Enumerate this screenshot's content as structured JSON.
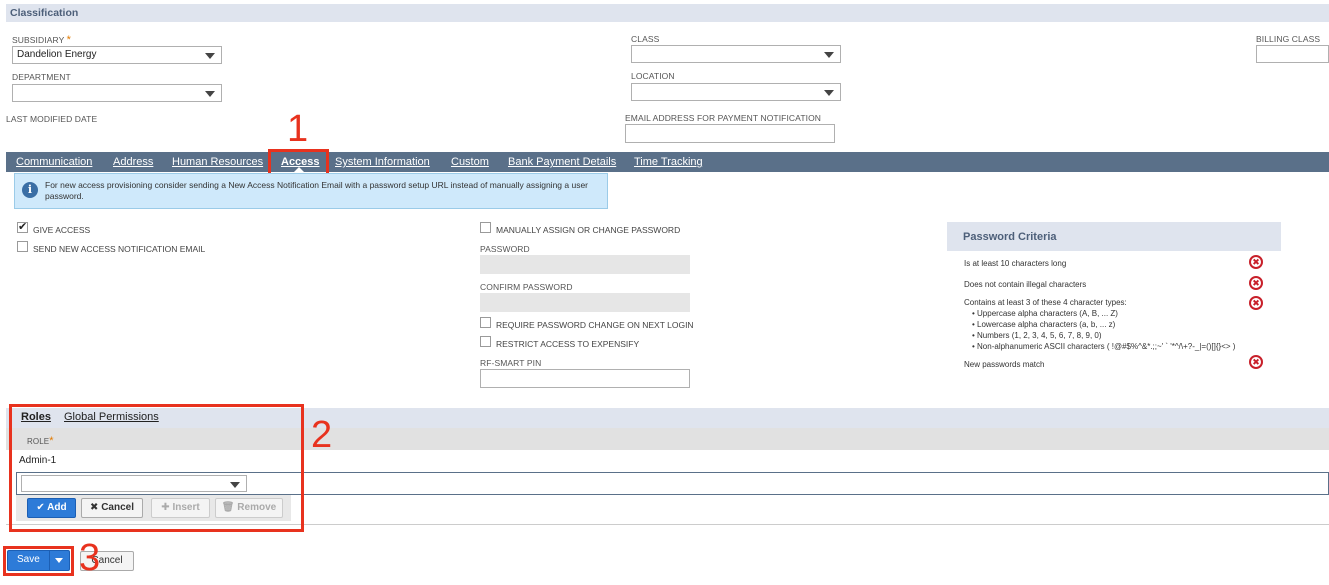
{
  "classification": {
    "title": "Classification",
    "subsidiary_label": "SUBSIDIARY",
    "required_star": "*",
    "subsidiary_value": "Dandelion Energy",
    "department_label": "DEPARTMENT",
    "class_label": "CLASS",
    "location_label": "LOCATION",
    "billing_class_label": "BILLING CLASS",
    "last_modified_label": "LAST MODIFIED DATE",
    "email_payment_label": "EMAIL ADDRESS FOR PAYMENT NOTIFICATION"
  },
  "tabs": [
    {
      "label": "Communication"
    },
    {
      "label": "Address"
    },
    {
      "label": "Human Resources"
    },
    {
      "label": "Access"
    },
    {
      "label": "System Information"
    },
    {
      "label": "Custom"
    },
    {
      "label": "Bank Payment Details"
    },
    {
      "label": "Time Tracking"
    }
  ],
  "annotations": {
    "one": "1",
    "two": "2",
    "three": "3"
  },
  "info_banner": {
    "icon": "i",
    "text": "For new access provisioning consider sending a New Access Notification Email with a password setup URL instead of manually assigning a user password."
  },
  "access": {
    "give_access": "GIVE ACCESS",
    "send_notification": "SEND NEW ACCESS NOTIFICATION EMAIL",
    "manually_assign": "MANUALLY ASSIGN OR CHANGE PASSWORD",
    "password_label": "PASSWORD",
    "confirm_password_label": "CONFIRM PASSWORD",
    "require_change": "REQUIRE PASSWORD CHANGE ON NEXT LOGIN",
    "restrict_access": "RESTRICT ACCESS TO EXPENSIFY",
    "rf_smart_pin_label": "RF-SMART PIN"
  },
  "password_criteria": {
    "title": "Password Criteria",
    "items": [
      "Is at least 10 characters long",
      "Does not contain illegal characters",
      "Contains at least 3 of these 4 character types:",
      "New passwords match"
    ],
    "types": [
      "• Uppercase alpha characters (A, B, ... Z)",
      "• Lowercase alpha characters (a, b, ... z)",
      "• Numbers (1, 2, 3, 4, 5, 6, 7, 8, 9, 0)",
      "• Non-alphanumeric ASCII characters ( !@#$%^&*.;;~' ` '*^/\\+?-_|=()[]{}<> )"
    ],
    "fail_icon": "✖"
  },
  "roles": {
    "tab_roles": "Roles",
    "tab_global_permissions": "Global Permissions",
    "role_header": "ROLE",
    "role_value": "Admin-1",
    "add": "Add",
    "cancel": "Cancel",
    "insert": "Insert",
    "remove": "Remove"
  },
  "footer": {
    "save": "Save",
    "cancel": "Cancel"
  }
}
